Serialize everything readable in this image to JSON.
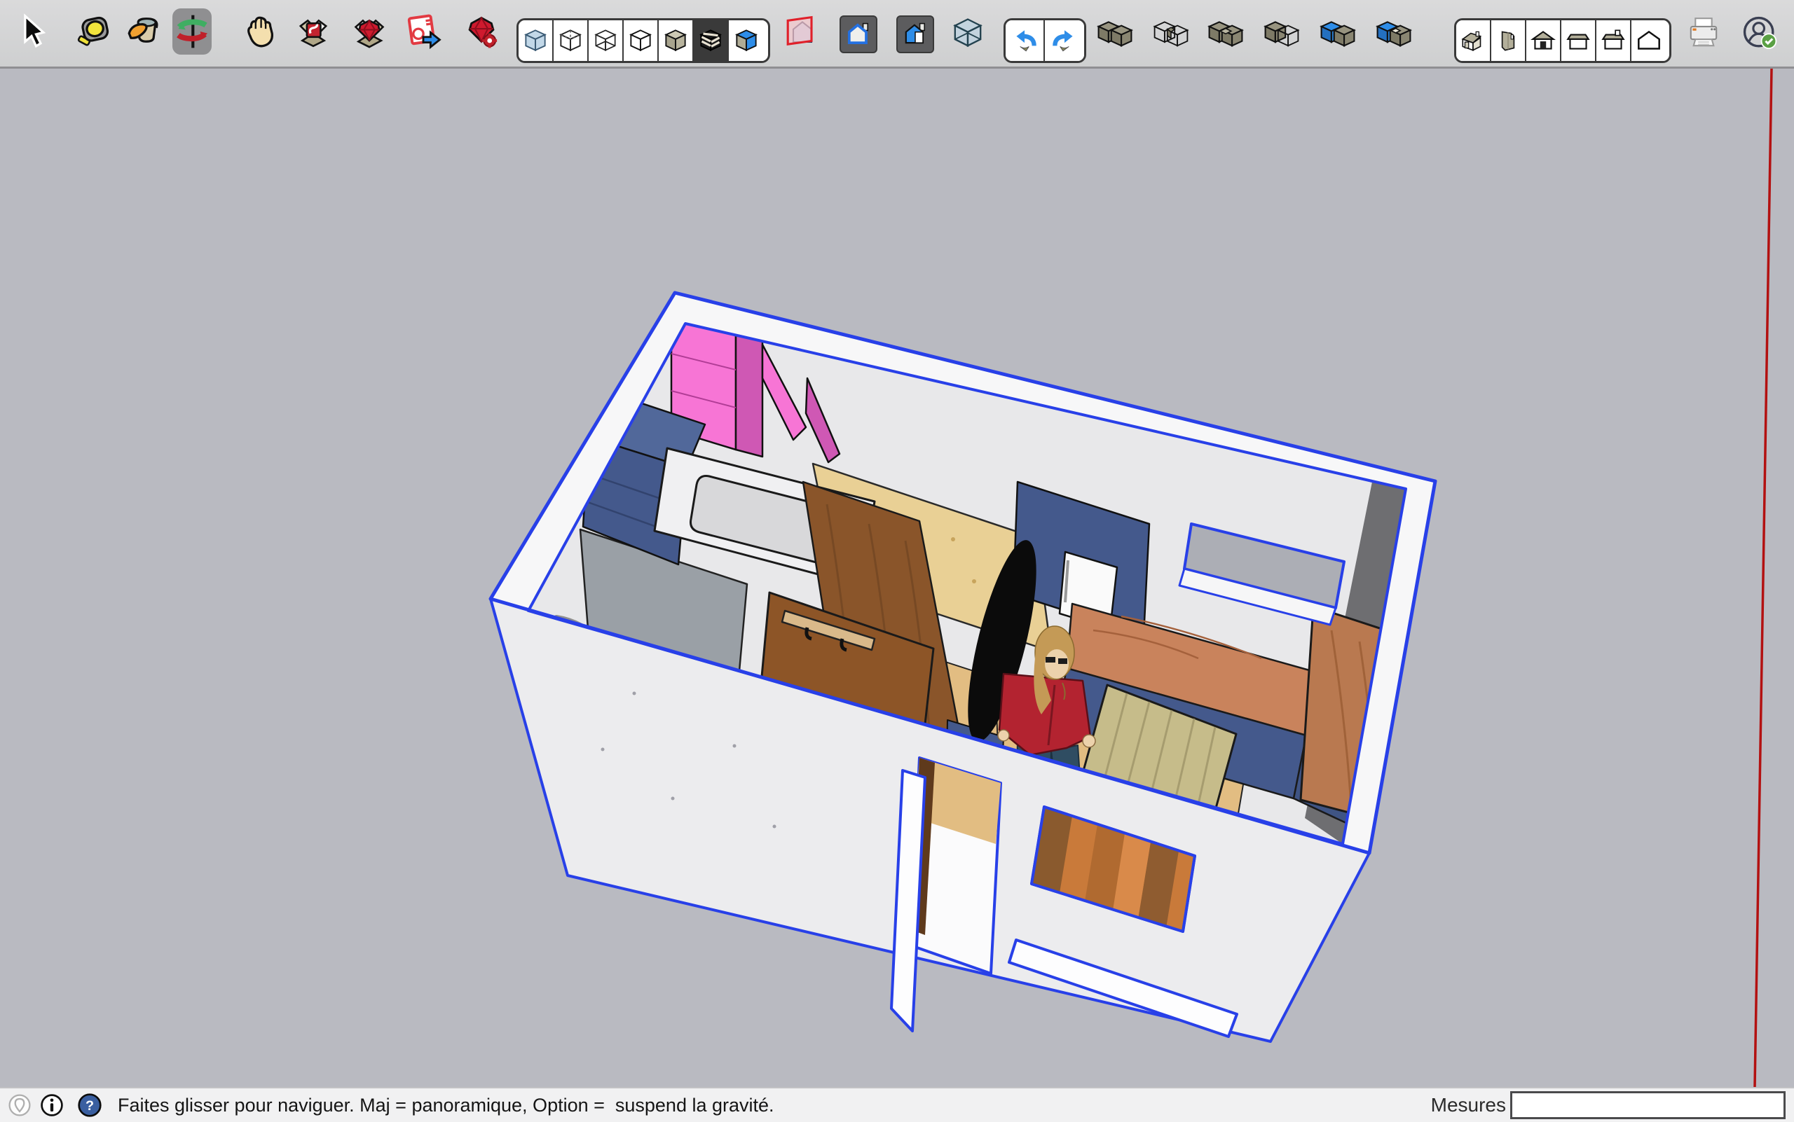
{
  "app": "SketchUp",
  "toolbar": {
    "groups": [
      {
        "name": "principal",
        "items": [
          {
            "name": "select",
            "icon": "cursor-icon",
            "active": false
          },
          {
            "name": "tape-measure",
            "icon": "tape-measure-icon",
            "active": false
          },
          {
            "name": "paint-bucket",
            "icon": "paint-bucket-icon",
            "active": false
          },
          {
            "name": "orbit",
            "icon": "orbit-icon",
            "active": true
          },
          {
            "name": "pan",
            "icon": "pan-hand-icon",
            "active": false
          }
        ]
      },
      {
        "name": "sketchup-extras",
        "items": [
          {
            "name": "components",
            "icon": "component-box-icon"
          },
          {
            "name": "extension-warehouse",
            "icon": "ruby-box-icon"
          },
          {
            "name": "send-to-layout",
            "icon": "layout-export-icon"
          },
          {
            "name": "extension-manager",
            "icon": "ruby-gear-icon"
          }
        ]
      },
      {
        "name": "face-styles",
        "items": [
          {
            "name": "xray",
            "pressed": false
          },
          {
            "name": "back-edges",
            "pressed": false
          },
          {
            "name": "wireframe",
            "pressed": false
          },
          {
            "name": "hidden-line",
            "pressed": false
          },
          {
            "name": "shaded",
            "pressed": false
          },
          {
            "name": "shaded-with-textures",
            "pressed": true
          },
          {
            "name": "monochrome",
            "pressed": false
          }
        ]
      },
      {
        "name": "sections",
        "items": [
          {
            "name": "section-plane",
            "pressed": false
          },
          {
            "name": "display-section-cuts",
            "pressed": true
          },
          {
            "name": "display-section-fills",
            "pressed": true
          },
          {
            "name": "section-display-box",
            "pressed": false
          }
        ]
      },
      {
        "name": "history",
        "items": [
          {
            "name": "undo"
          },
          {
            "name": "redo"
          }
        ]
      },
      {
        "name": "solid-tools",
        "items": [
          {
            "name": "outer-shell"
          },
          {
            "name": "intersect"
          },
          {
            "name": "union"
          },
          {
            "name": "subtract"
          },
          {
            "name": "trim"
          },
          {
            "name": "split"
          }
        ]
      },
      {
        "name": "standard-views",
        "items": [
          {
            "name": "view-iso"
          },
          {
            "name": "view-top"
          },
          {
            "name": "view-front"
          },
          {
            "name": "view-right"
          },
          {
            "name": "view-back"
          },
          {
            "name": "view-left"
          }
        ]
      },
      {
        "name": "output",
        "items": [
          {
            "name": "print"
          },
          {
            "name": "account",
            "signed_in": true
          }
        ]
      }
    ]
  },
  "statusbar": {
    "icons": [
      "geolocation-icon",
      "credits-info-icon",
      "help-icon"
    ],
    "message": "Faites glisser pour naviguer. Maj = panoramique, Option =  suspend la gravité.",
    "measurements_label": "Mesures",
    "measurements_value": ""
  },
  "palette": {
    "canvas": "#b9bac1",
    "sel": "#2840e8",
    "axisRed": "#b31111",
    "rimWhite": "#f7f7f8",
    "wallWhite": "#ececee",
    "interior": "#e8e8ea",
    "wallDark": "#6e6e71",
    "pink": "#f775d5",
    "pinkDark": "#cf58b4",
    "blueFurn": "#51689a",
    "blueFurnDark": "#44598c",
    "grayShower": "#9aa0a6",
    "grayShowerDark": "#878d93",
    "woodBrown": "#8a552a",
    "ply": "#e9d095",
    "salmon": "#c9835c",
    "tableWood": "#c6bc8a",
    "floorWood": "#e2bd82",
    "floorDark": "#c98a45",
    "skin": "#ecd2ac",
    "hair": "#c49a56",
    "jacket": "#b32330",
    "pants": "#2f4d62",
    "bag": "#9a6a3c"
  },
  "model": {
    "selection": "tiny-house interior model, all edges selected (blue)",
    "figure": "woman with red jacket and handbag"
  }
}
